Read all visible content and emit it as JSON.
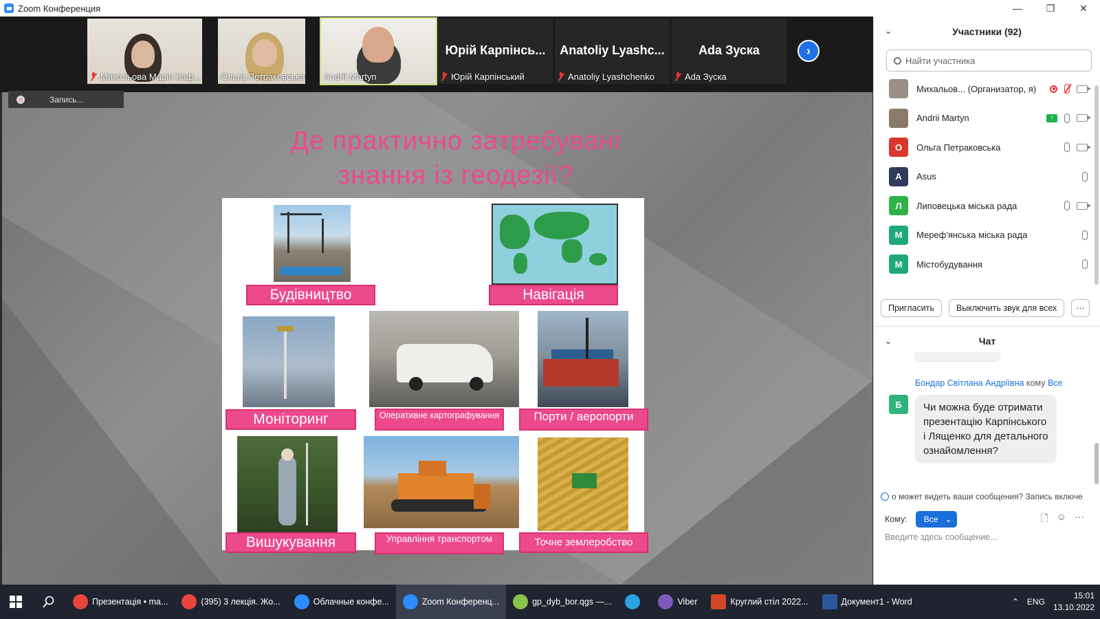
{
  "window": {
    "title": "Zoom Конференция",
    "minimize": "—",
    "restore": "❐",
    "close": "✕"
  },
  "gallery": {
    "tiles": [
      {
        "name": "Михальова Марія Каф...",
        "muted": true,
        "video": true
      },
      {
        "name": "Ольга Петраковська",
        "muted": false,
        "video": true
      },
      {
        "name": "Andrii Martyn",
        "muted": false,
        "video": true,
        "active": true
      },
      {
        "big": "Юрій Карпінсь...",
        "name": "Юрій Карпінський",
        "muted": true
      },
      {
        "big": "Anatoliy  Lyashc...",
        "name": "Anatoliy Lyashchenko",
        "muted": true
      },
      {
        "big": "Ada Зуска",
        "name": "Ada Зуска",
        "muted": true
      }
    ],
    "next": "›"
  },
  "recording": {
    "label": "Запись..."
  },
  "slide": {
    "title_line1": "Де практично затребувані",
    "title_line2": "знання із геодезії?",
    "labels": {
      "construction": "Будівництво",
      "navigation": "Навігація",
      "monitoring": "Моніторинг",
      "mapping": "Оперативне картографування",
      "ports": "Порти / аеропорти",
      "survey": "Вишукування",
      "transport": "Управління транспортом",
      "farming": "Точне землеробство"
    }
  },
  "participants": {
    "header": "Участники (92)",
    "search_placeholder": "Найти участника",
    "list": [
      {
        "initial": "",
        "name": "Михальов...  (Организатор, я)",
        "color": "#9a8f84"
      },
      {
        "initial": "",
        "name": "Andrii Martyn",
        "color": "#8a7a68"
      },
      {
        "initial": "О",
        "name": "Ольга Петраковська",
        "color": "#d9372b"
      },
      {
        "initial": "A",
        "name": "Asus",
        "color": "#2f3b5c"
      },
      {
        "initial": "Л",
        "name": "Липовецька міська рада",
        "color": "#2fb348"
      },
      {
        "initial": "М",
        "name": "Мереф'янська міська рада",
        "color": "#1fa97a"
      },
      {
        "initial": "М",
        "name": "Містобудування",
        "color": "#1fa97a"
      }
    ],
    "invite": "Пригласить",
    "mute_all": "Выключить звук для всех",
    "more": "···"
  },
  "chat": {
    "header": "Чат",
    "from": "Бондар Світлана Андріївна",
    "to_word": "кому",
    "to": "Все",
    "avatar_initial": "Б",
    "message": "Чи можна буде отримати презентацію Карпінського і Лященко для детального ознайомлення?",
    "notice": "о может видеть ваши сообщения? Запись включе",
    "to_label": "Кому:",
    "to_value": "Все",
    "input_placeholder": "Введите здесь сообщение..."
  },
  "taskbar": {
    "items": [
      {
        "label": "Презентація • ma...",
        "color": "#e8453c"
      },
      {
        "label": "(395) 3 лекція. Жо...",
        "color": "#e8453c"
      },
      {
        "label": "Облачные конфе...",
        "color": "#2d8cff"
      },
      {
        "label": "Zoom Конференц...",
        "color": "#2d8cff",
        "active": true
      },
      {
        "label": "gp_dyb_bor.qgs —...",
        "color": "#8bc34a"
      },
      {
        "label": "",
        "color": "#2aa3e0"
      },
      {
        "label": "Viber",
        "color": "#7d5bbe"
      },
      {
        "label": "Круглий стіл 2022...",
        "color": "#d24726"
      },
      {
        "label": "Документ1 - Word",
        "color": "#2b579a"
      }
    ],
    "lang": "ENG",
    "time": "15:01",
    "date": "13.10.2022"
  }
}
